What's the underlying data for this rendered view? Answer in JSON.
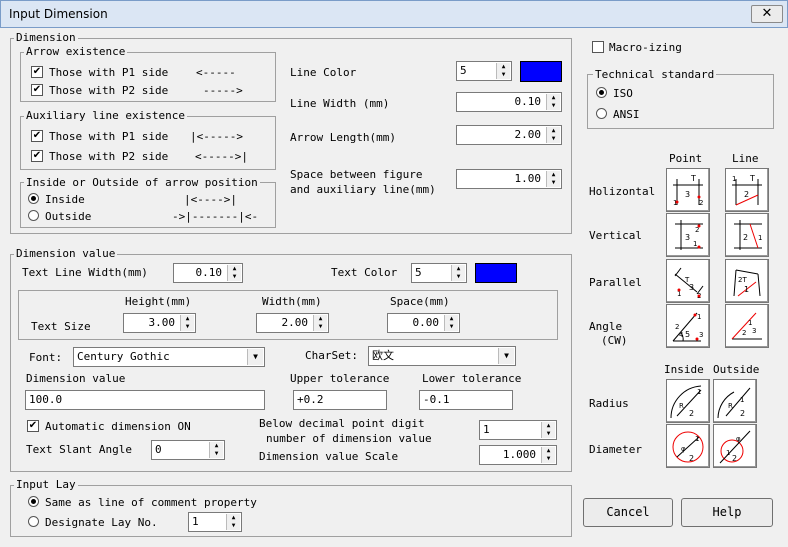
{
  "window": {
    "title": "Input Dimension",
    "close": "✕"
  },
  "dimension": {
    "legend": "Dimension",
    "arrow_existence": {
      "legend": "Arrow existence",
      "p1_label": "Those with P1 side",
      "p1_glyph": "<-----",
      "p2_label": "Those with P2 side",
      "p2_glyph": "----->"
    },
    "aux_existence": {
      "legend": "Auxiliary line existence",
      "p1_label": "Those with P1 side",
      "p1_glyph": "|<----->",
      "p2_label": "Those with P2 side",
      "p2_glyph": "<----->|"
    },
    "arrow_position": {
      "legend": "Inside or Outside of arrow position",
      "inside_label": "Inside",
      "inside_glyph": "|<---->|",
      "outside_label": "Outside",
      "outside_glyph": "->|-------|<-"
    },
    "line_color": {
      "label": "Line Color",
      "value": "5",
      "color": "#0000ff"
    },
    "line_width": {
      "label": "Line Width (mm)",
      "value": "0.10"
    },
    "arrow_length": {
      "label": "Arrow Length(mm)",
      "value": "2.00"
    },
    "space_between": {
      "label1": "Space between figure",
      "label2": "and auxiliary line(mm)",
      "value": "1.00"
    }
  },
  "macro": {
    "label": "Macro-izing"
  },
  "technical_standard": {
    "legend": "Technical standard",
    "iso": "ISO",
    "ansi": "ANSI"
  },
  "icon_panel": {
    "col_point": "Point",
    "col_line": "Line",
    "holizontal": "Holizontal",
    "vertical": "Vertical",
    "parallel": "Parallel",
    "angle1": "Angle",
    "angle2": "(CW)",
    "inside": "Inside",
    "outside": "Outside",
    "radius": "Radius",
    "diameter": "Diameter"
  },
  "dimension_value": {
    "legend": "Dimension value",
    "text_line_width": {
      "label": "Text Line Width(mm)",
      "value": "0.10"
    },
    "text_color": {
      "label": "Text Color",
      "value": "5",
      "color": "#0000ff"
    },
    "text_size": {
      "label": "Text Size",
      "height_label": "Height(mm)",
      "height": "3.00",
      "width_label": "Width(mm)",
      "width": "2.00",
      "space_label": "Space(mm)",
      "space": "0.00"
    },
    "font": {
      "label": "Font:",
      "value": "Century Gothic"
    },
    "charset": {
      "label": "CharSet:",
      "value": "欧文"
    },
    "dim_value": {
      "label": "Dimension value",
      "value": "100.0"
    },
    "upper_tol": {
      "label": "Upper tolerance",
      "value": "+0.2"
    },
    "lower_tol": {
      "label": "Lower tolerance",
      "value": "-0.1"
    },
    "auto_dim": {
      "label": "Automatic dimension ON"
    },
    "slant": {
      "label": "Text Slant Angle",
      "value": "0"
    },
    "decimal": {
      "label1": "Below decimal point digit",
      "label2": "number of dimension value",
      "value": "1"
    },
    "scale": {
      "label": "Dimension value Scale",
      "value": "1.000"
    }
  },
  "input_lay": {
    "legend": "Input Lay",
    "same_label": "Same as line of comment property",
    "designate_label": "Designate Lay No.",
    "value": "1"
  },
  "buttons": {
    "cancel": "Cancel",
    "help": "Help"
  }
}
